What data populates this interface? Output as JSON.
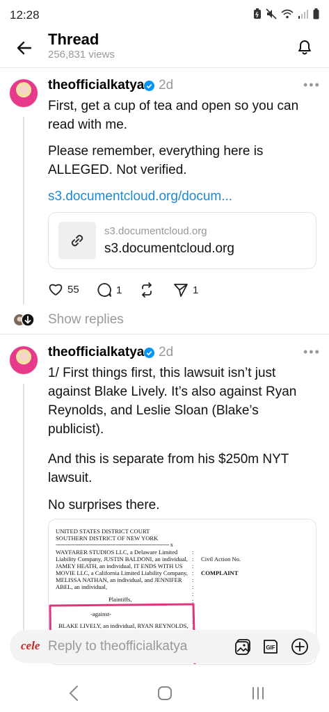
{
  "status_bar": {
    "time": "12:28"
  },
  "header": {
    "title": "Thread",
    "views": "256,831 views"
  },
  "posts": [
    {
      "username": "theofficialkatya",
      "time": "2d",
      "paragraphs": [
        "First, get a cup of tea and open so you can",
        "read with me.",
        "Please remember, everything here is",
        "ALLEGED. Not verified."
      ],
      "link": "s3.documentcloud.org/docum...",
      "link_card": {
        "domain": "s3.documentcloud.org",
        "title": "s3.documentcloud.org"
      },
      "likes": "55",
      "comments": "1",
      "shares": "1"
    },
    {
      "username": "theofficialkatya",
      "time": "2d",
      "paragraphs": [
        "1/ First things first, this lawsuit isn’t just",
        "against Blake Lively. It’s also against Ryan",
        "Reynolds, and Leslie Sloan (Blake’s",
        "publicist).",
        "And this is separate from his $250m NYT",
        "lawsuit.",
        "No surprises there."
      ]
    }
  ],
  "show_replies": "Show replies",
  "document": {
    "court_line1": "UNITED STATES DISTRICT COURT",
    "court_line2": "SOUTHERN DISTRICT OF NEW YORK",
    "rule": "--------------------------------------------------------------------- x",
    "plaintiff_lines": [
      "WAYFARER STUDIOS LLC, a Delaware Limited",
      "Liability Company, JUSTIN BALDONI, an individual,",
      "JAMEY HEATH, an individual, IT ENDS WITH US",
      "MOVIE LLC, a California Limited Liability Company,",
      "MELISSA NATHAN, an individual, and JENNIFER",
      "ABEL, an individual,"
    ],
    "civil_action": "Civil Action No.",
    "complaint": "COMPLAINT",
    "plaintiffs": "Plaintiffs,",
    "against": "-against-",
    "defendants_line": "BLAKE LIVELY, an individual, RYAN REYNOLDS,"
  },
  "reply_bar": {
    "logo": "cele",
    "placeholder": "Reply to theofficialkatya"
  },
  "colors": {
    "link": "#1a8ad6",
    "verified": "#0095f6",
    "highlight": "#e0357e"
  }
}
